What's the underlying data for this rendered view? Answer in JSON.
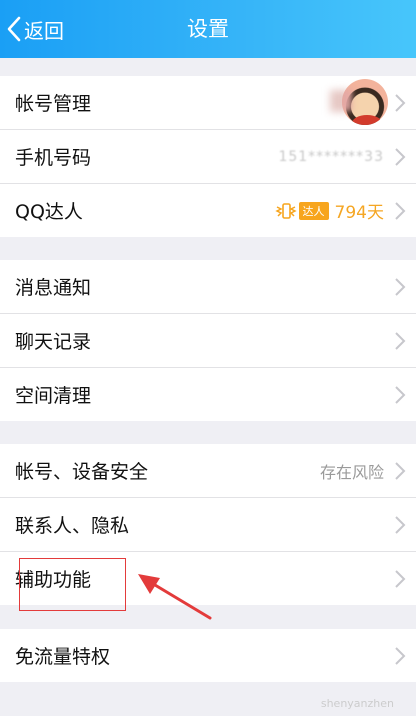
{
  "header": {
    "back_label": "返回",
    "title": "设置"
  },
  "group1": {
    "account": {
      "label": "帐号管理"
    },
    "phone": {
      "label": "手机号码",
      "value_masked": "151*******33"
    },
    "qq_talent": {
      "label": "QQ达人",
      "badge": "达人",
      "days": "794天"
    }
  },
  "group2": {
    "items": [
      {
        "label": "消息通知"
      },
      {
        "label": "聊天记录"
      },
      {
        "label": "空间清理"
      }
    ]
  },
  "group3": {
    "security": {
      "label": "帐号、设备安全",
      "status": "存在风险"
    },
    "privacy": {
      "label": "联系人、隐私"
    },
    "accessibility": {
      "label": "辅助功能"
    }
  },
  "group4": {
    "traffic": {
      "label": "免流量特权"
    }
  },
  "colors": {
    "accent": "#1a9ff5",
    "warning": "#f5a623",
    "annotation": "#e33b3b"
  },
  "watermark": "shenyanzhen"
}
